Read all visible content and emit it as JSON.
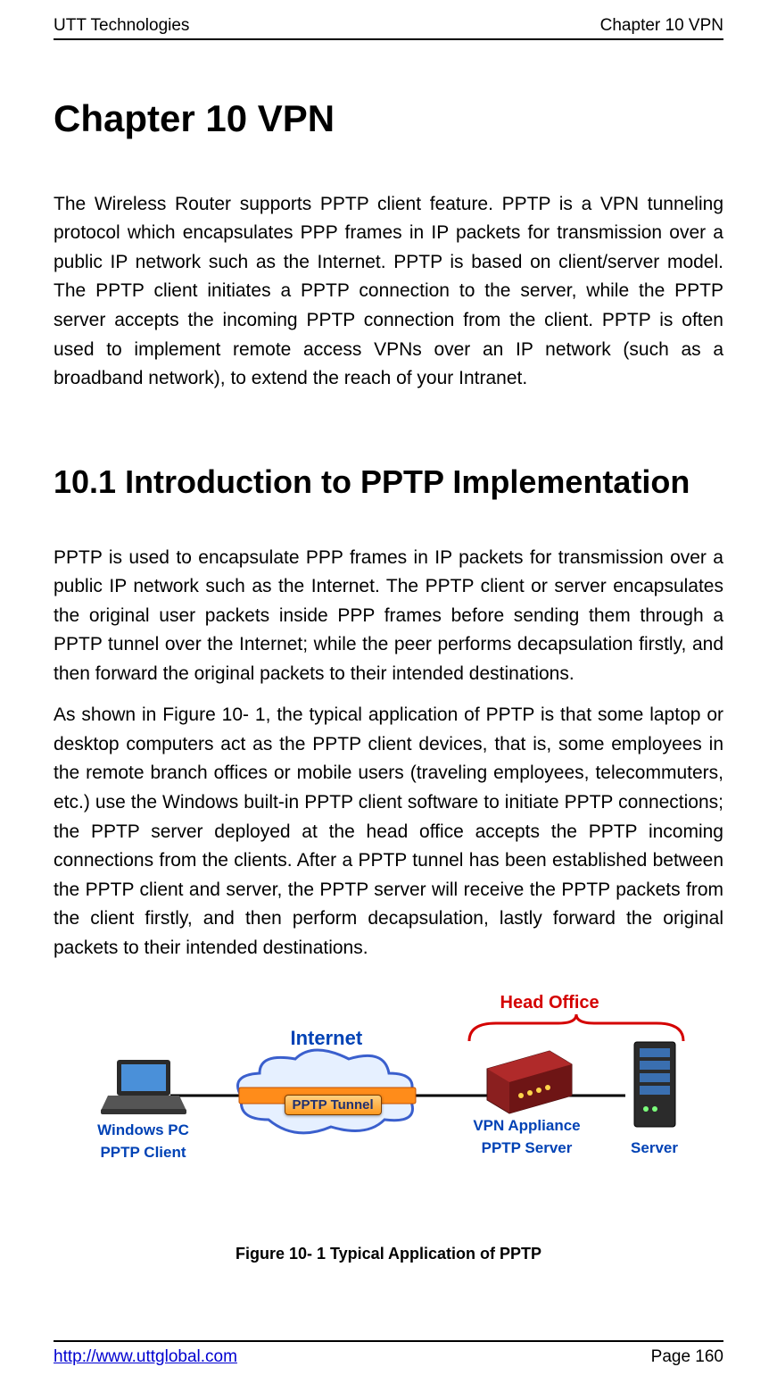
{
  "header": {
    "left": "UTT Technologies",
    "right": "Chapter 10 VPN"
  },
  "chapter_title": "Chapter 10  VPN",
  "intro": "The Wireless Router supports PPTP client feature. PPTP is a VPN tunneling protocol which encapsulates PPP frames in IP packets for transmission over a public IP network such as the Internet. PPTP is based on client/server model. The PPTP client initiates a PPTP connection to the server, while the PPTP server accepts the incoming PPTP connection from the client. PPTP is often used to implement remote access VPNs over an IP network (such as a broadband network), to extend the reach of your Intranet.",
  "section_title": "10.1   Introduction to PPTP Implementation",
  "para1": "PPTP is used to encapsulate PPP frames in IP packets for transmission over a public IP network such as the Internet. The PPTP client or server encapsulates the original user packets inside PPP frames before sending them through a PPTP tunnel over the Internet; while the peer performs decapsulation firstly, and then forward the original packets to their intended destinations.",
  "para2": "As shown in Figure 10- 1, the typical application of PPTP is that some laptop or desktop computers act as the PPTP client devices, that is, some employees in the remote branch offices or mobile users (traveling employees, telecommuters, etc.) use the Windows built-in PPTP client software to initiate PPTP connections; the PPTP server deployed at the head office accepts the PPTP incoming connections from the clients. After a PPTP tunnel has been established between the PPTP client and server, the PPTP server will receive the PPTP packets from the client firstly, and then perform decapsulation, lastly forward the original packets to their intended destinations.",
  "figure": {
    "head_office": "Head Office",
    "internet": "Internet",
    "pptp_tunnel": "PPTP Tunnel",
    "windows_pc": "Windows PC",
    "pptp_client": "PPTP Client",
    "vpn_appliance": "VPN Appliance",
    "pptp_server": "PPTP Server",
    "server": "Server",
    "caption": "Figure 10- 1 Typical Application of PPTP"
  },
  "footer": {
    "url": "http://www.uttglobal.com",
    "page": "Page 160"
  }
}
